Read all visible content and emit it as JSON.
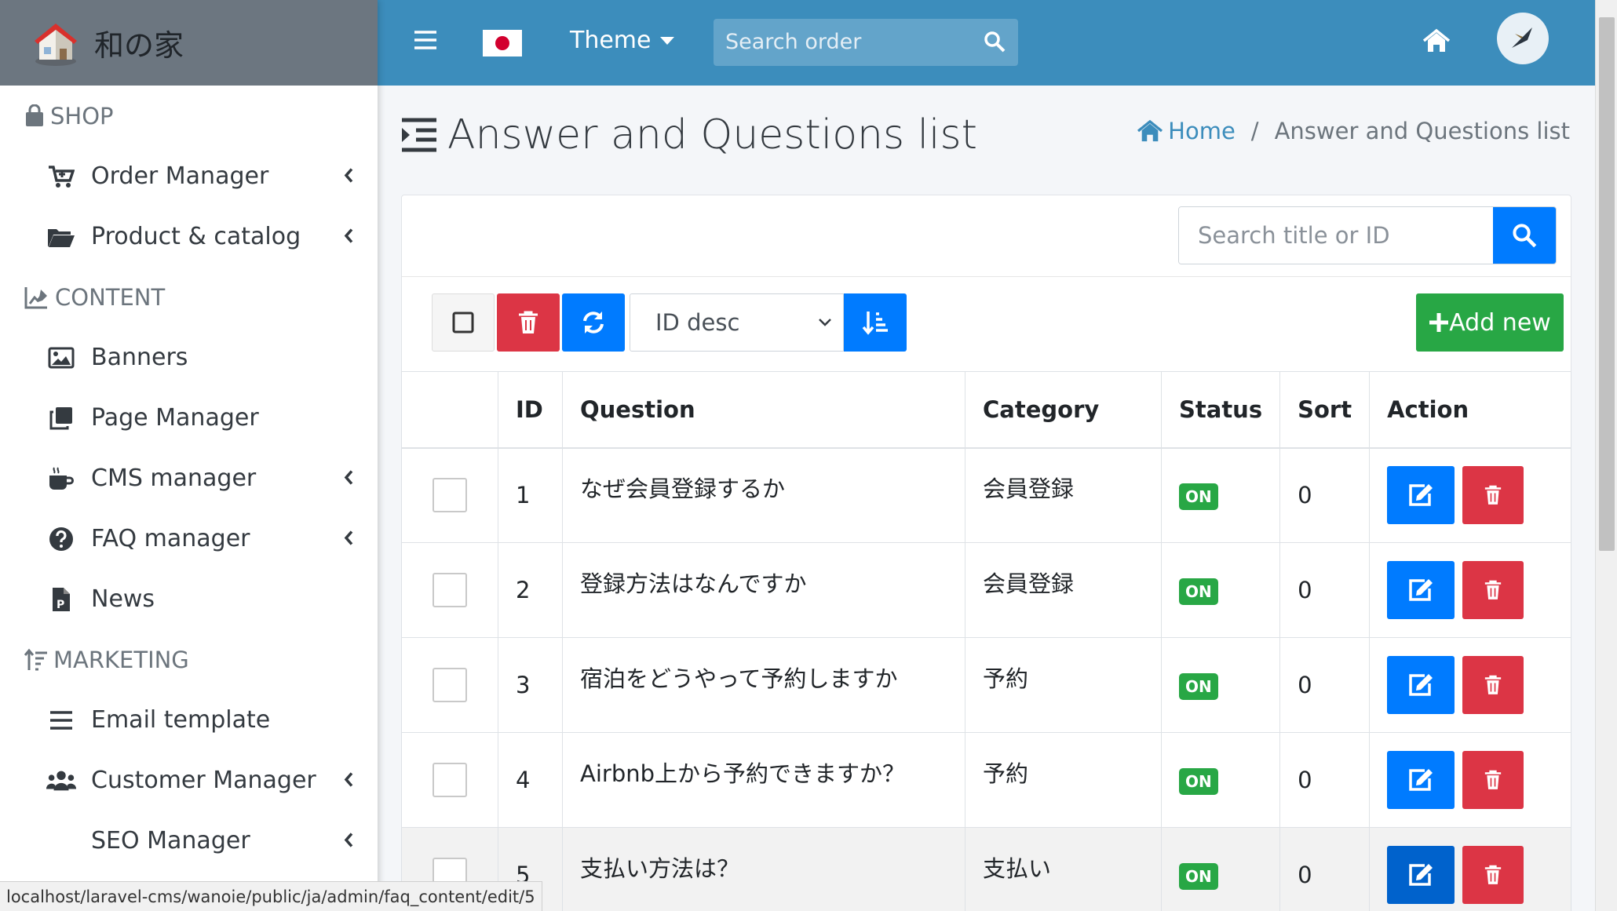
{
  "brand": {
    "name": "和の家"
  },
  "sidebar": {
    "sections": [
      {
        "header": "SHOP",
        "icon": "shopping-bag-icon",
        "items": [
          {
            "label": "Order Manager",
            "icon": "cart-icon",
            "chevron": true
          },
          {
            "label": "Product & catalog",
            "icon": "folder-open-icon",
            "chevron": true
          }
        ]
      },
      {
        "header": "CONTENT",
        "icon": "chart-edit-icon",
        "items": [
          {
            "label": "Banners",
            "icon": "image-icon",
            "chevron": false
          },
          {
            "label": "Page Manager",
            "icon": "clone-icon",
            "chevron": false
          },
          {
            "label": "CMS manager",
            "icon": "coffee-icon",
            "chevron": true
          },
          {
            "label": "FAQ manager",
            "icon": "question-circle-icon",
            "chevron": true
          },
          {
            "label": "News",
            "icon": "file-p-icon",
            "chevron": false
          }
        ]
      },
      {
        "header": "MARKETING",
        "icon": "sort-amount-icon",
        "items": [
          {
            "label": "Email template",
            "icon": "list-icon",
            "chevron": false
          },
          {
            "label": "Customer Manager",
            "icon": "users-icon",
            "chevron": true
          },
          {
            "label": "SEO Manager",
            "icon": "",
            "chevron": true
          }
        ]
      }
    ]
  },
  "topbar": {
    "theme_label": "Theme",
    "search_placeholder": "Search order",
    "icons": [
      "hamburger-icon",
      "japan-flag-icon",
      "search-icon",
      "home-icon",
      "avatar"
    ]
  },
  "page": {
    "title": "Answer and Questions list",
    "breadcrumb": {
      "home": "Home",
      "separator": "/",
      "current": "Answer and Questions list"
    }
  },
  "card": {
    "search_placeholder": "Search title or ID",
    "sort_value": "ID desc",
    "add_new_label": "Add new"
  },
  "table": {
    "headers": [
      "",
      "ID",
      "Question",
      "Category",
      "Status",
      "Sort",
      "Action"
    ],
    "rows": [
      {
        "id": "1",
        "question": "なぜ会員登録するか",
        "category": "会員登録",
        "status": "ON",
        "sort": "0"
      },
      {
        "id": "2",
        "question": "登録方法はなんですか",
        "category": "会員登録",
        "status": "ON",
        "sort": "0"
      },
      {
        "id": "3",
        "question": "宿泊をどうやって予約しますか",
        "category": "予約",
        "status": "ON",
        "sort": "0"
      },
      {
        "id": "4",
        "question": "Airbnb上から予約できますか？",
        "category": "予約",
        "status": "ON",
        "sort": "0"
      },
      {
        "id": "5",
        "question": "支払い方法は？",
        "category": "支払い",
        "status": "ON",
        "sort": "0"
      }
    ]
  },
  "statusbar": {
    "url": "localhost/laravel-cms/wanoie/public/ja/admin/faq_content/edit/5"
  },
  "colors": {
    "topbar": "#3c8dbc",
    "primary": "#007bff",
    "danger": "#dc3545",
    "success": "#28a745",
    "brand_bg": "#6c7680"
  }
}
